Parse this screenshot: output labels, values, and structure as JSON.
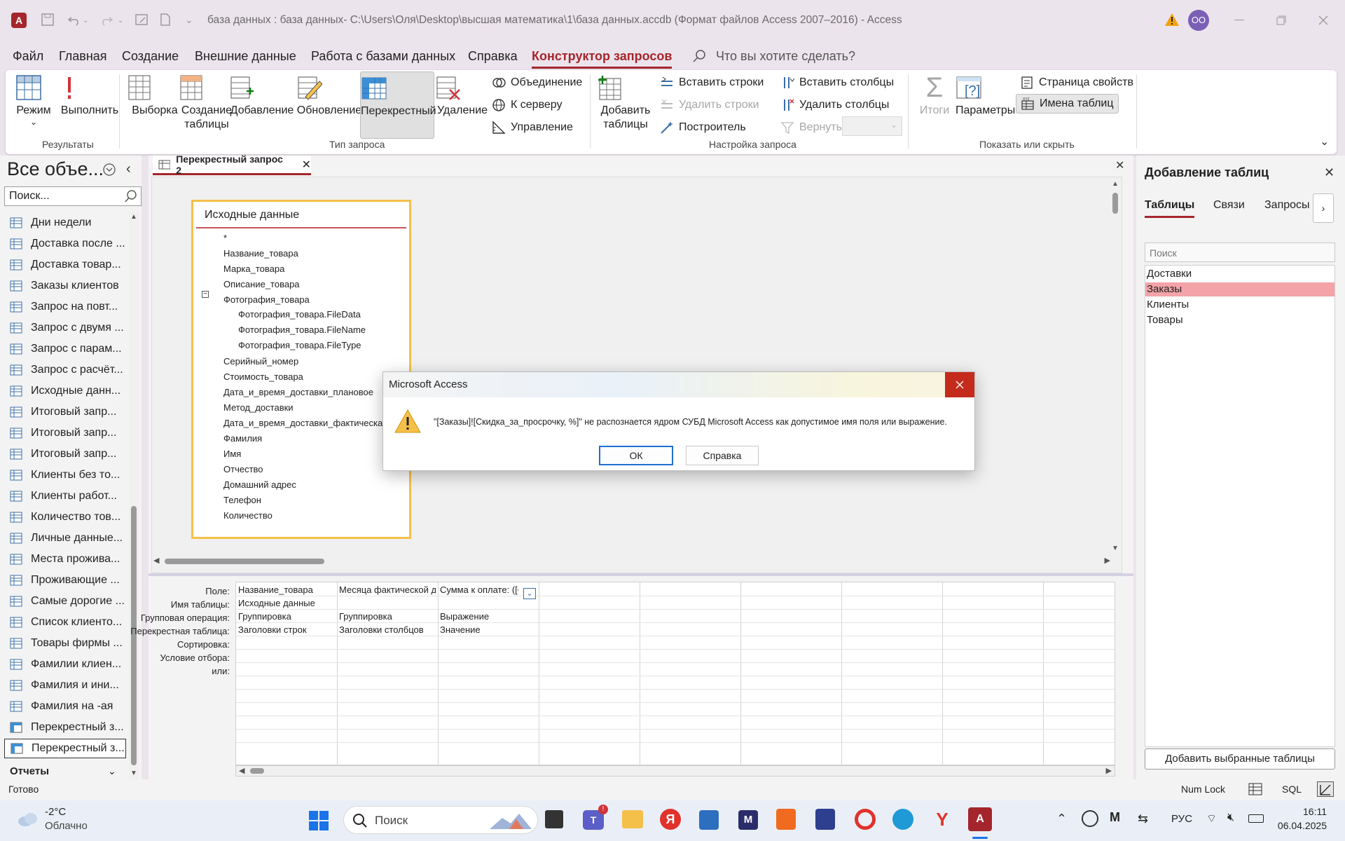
{
  "app": {
    "title": "база данных : база данных- C:\\Users\\Оля\\Desktop\\высшая математика\\1\\база данных.accdb (Формат файлов Access 2007–2016)  -  Access",
    "avatar_initials": "OO",
    "colors": {
      "accent": "#a4262c",
      "selected_table_bg": "#f4a3a8",
      "highlight_border": "#f5c04a"
    }
  },
  "menu": {
    "items": [
      "Файл",
      "Главная",
      "Создание",
      "Внешние данные",
      "Работа с базами данных",
      "Справка",
      "Конструктор запросов"
    ],
    "active_index": 6,
    "search_placeholder": "Что вы хотите сделать?"
  },
  "ribbon": {
    "results": {
      "mode": "Режим",
      "run": "Выполнить",
      "group": "Результаты"
    },
    "query_type": {
      "select": "Выборка",
      "make_table": "Создание таблицы",
      "append": "Добавление",
      "update": "Обновление",
      "crosstab": "Перекрестный",
      "delete": "Удаление",
      "union": "Объединение",
      "pass_through": "К серверу",
      "ddl": "Управление",
      "group": "Тип запроса"
    },
    "setup": {
      "add_tables": "Добавить таблицы",
      "insert_rows": "Вставить строки",
      "delete_rows": "Удалить строки",
      "builder": "Построитель",
      "insert_cols": "Вставить столбцы",
      "delete_cols": "Удалить столбцы",
      "return": "Вернуть:",
      "group": "Настройка запроса"
    },
    "show_hide": {
      "totals": "Итоги",
      "params": "Параметры",
      "property_sheet": "Страница свойств",
      "table_names": "Имена таблиц",
      "group": "Показать или скрыть"
    }
  },
  "nav": {
    "title": "Все объе...",
    "search_placeholder": "Поиск...",
    "items": [
      "Дни недели",
      "Доставка после ...",
      "Доставка товар...",
      "Заказы клиентов",
      "Запрос на повт...",
      "Запрос с двумя ...",
      "Запрос с парам...",
      "Запрос с расчёт...",
      "Исходные данн...",
      "Итоговый запр...",
      "Итоговый запр...",
      "Итоговый запр...",
      "Клиенты без то...",
      "Клиенты работ...",
      "Количество тов...",
      "Личные данные...",
      "Места прожива...",
      "Проживающие ...",
      "Самые дорогие ...",
      "Список клиенто...",
      "Товары фирмы ...",
      "Фамилии клиен...",
      "Фамилия и ини...",
      "Фамилия на -ая",
      "Перекрестный з...",
      "Перекрестный з..."
    ],
    "selected_index": 25,
    "section_reports": "Отчеты"
  },
  "document": {
    "tab_title": "Перекрестный запрос 2",
    "table": {
      "title": "Исходные данные",
      "fields": [
        "*",
        "Название_товара",
        "Марка_товара",
        "Описание_товара",
        "Фотография_товара",
        "Фотография_товара.FileData",
        "Фотография_товара.FileName",
        "Фотография_товара.FileType",
        "Серийный_номер",
        "Стоимость_товара",
        "Дата_и_время_доставки_плановое",
        "Метод_доставки",
        "Дата_и_время_доставки_фактическая",
        "Фамилия",
        "Имя",
        "Отчество",
        "Домашний адрес",
        "Телефон",
        "Количество"
      ]
    },
    "grid": {
      "row_labels": [
        "Поле:",
        "Имя таблицы:",
        "Групповая операция:",
        "Перекрестная таблица:",
        "Сортировка:",
        "Условие отбора:",
        "или:"
      ],
      "columns": [
        [
          "Название_товара",
          "Исходные данные",
          "Группировка",
          "Заголовки строк"
        ],
        [
          "Месяца фактической до",
          "",
          "Группировка",
          "Заголовки столбцов"
        ],
        [
          "Сумма к оплате: ([C",
          "",
          "Выражение",
          "Значение"
        ]
      ]
    }
  },
  "right_pane": {
    "title": "Добавление таблиц",
    "tabs": [
      "Таблицы",
      "Связи",
      "Запросы"
    ],
    "search_placeholder": "Поиск",
    "tables": [
      "Доставки",
      "Заказы",
      "Клиенты",
      "Товары"
    ],
    "selected_index": 1,
    "add_button": "Добавить выбранные таблицы"
  },
  "status": {
    "ready": "Готово",
    "num_lock": "Num Lock",
    "sql": "SQL"
  },
  "taskbar": {
    "temp": "-2°C",
    "weather": "Облачно",
    "search": "Поиск",
    "lang": "РУС",
    "time": "16:11",
    "date": "06.04.2025"
  },
  "dialog": {
    "title": "Microsoft Access",
    "message": "\"[Заказы]![Скидка_за_просрочку, %]\" не распознается ядром СУБД Microsoft Access как допустимое имя поля или выражение.",
    "ok": "ОК",
    "help": "Справка"
  }
}
